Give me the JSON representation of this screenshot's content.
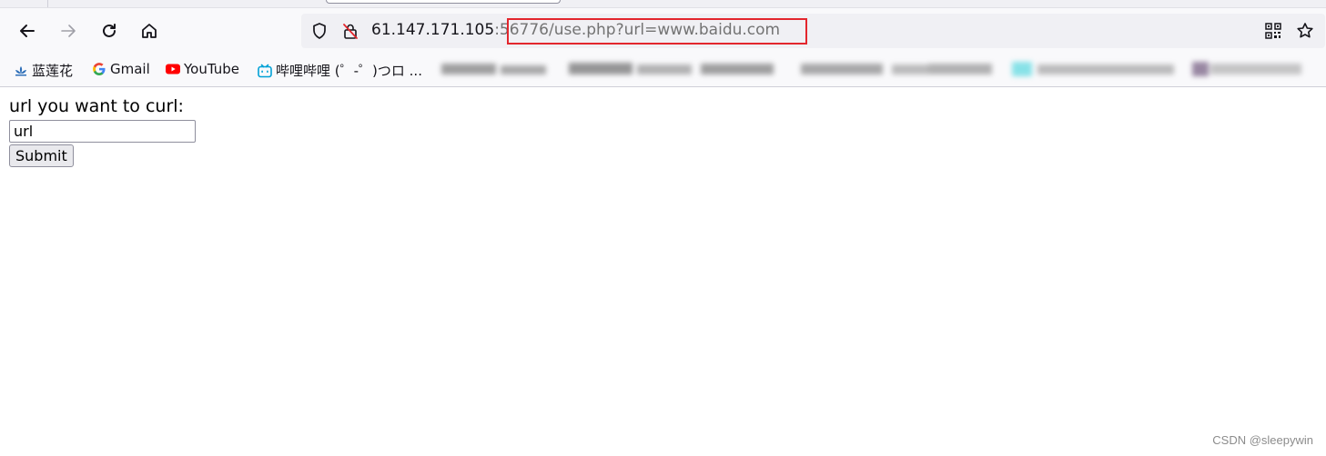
{
  "toolbar": {
    "url_host": "61.147.171.105",
    "url_port_part": ":56",
    "url_path": "776/use.php?url=www.baidu.com"
  },
  "bookmarks": [
    {
      "label": "蓝莲花",
      "icon": "lotus-icon"
    },
    {
      "label": "Gmail",
      "icon": "google-icon"
    },
    {
      "label": "YouTube",
      "icon": "youtube-icon"
    },
    {
      "label": "哔哩哔哩 (゜-゜)つロ ...",
      "icon": "bilibili-icon"
    }
  ],
  "page": {
    "prompt": "url you want to curl:",
    "input_value": "url",
    "submit_label": "Submit"
  },
  "watermark": "CSDN @sleepywin",
  "colors": {
    "highlight_box": "#e3262d",
    "youtube_red": "#ff0000",
    "bilibili_blue": "#00a1d6"
  }
}
